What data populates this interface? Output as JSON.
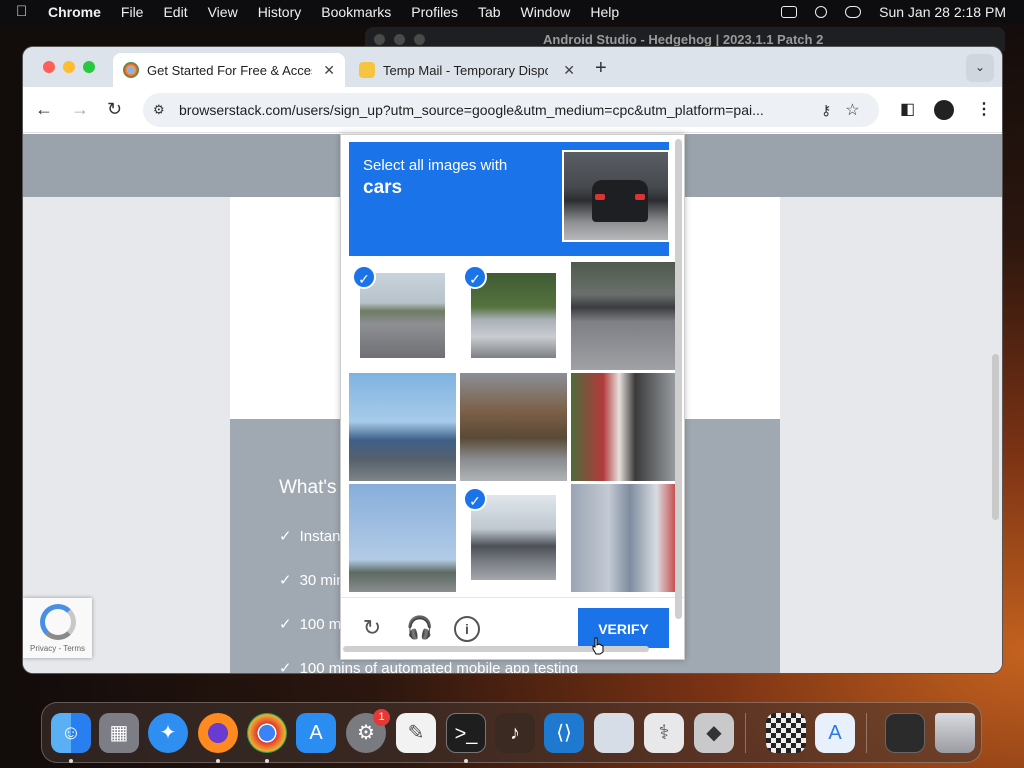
{
  "menubar": {
    "app": "Chrome",
    "menus": [
      "File",
      "Edit",
      "View",
      "History",
      "Bookmarks",
      "Profiles",
      "Tab",
      "Window",
      "Help"
    ],
    "clock": "Sun Jan 28  2:18 PM"
  },
  "background_window": {
    "title": "Android Studio - Hedgehog | 2023.1.1 Patch 2"
  },
  "tabs": [
    {
      "label": "Get Started For Free & Access",
      "active": true
    },
    {
      "label": "Temp Mail - Temporary Dispo",
      "active": false
    }
  ],
  "toolbar": {
    "url": "browserstack.com/users/sign_up?utm_source=google&utm_medium=cpc&utm_platform=pai..."
  },
  "page": {
    "heading": "What's",
    "features": [
      "Instant",
      "30 min",
      "100 m",
      "100 mins of automated mobile app testing"
    ],
    "recaptcha_links": "Privacy - Terms"
  },
  "captcha": {
    "instruction": "Select all images with",
    "target": "cars",
    "verify_label": "VERIFY",
    "tiles": [
      {
        "selected": true
      },
      {
        "selected": true
      },
      {
        "selected": false
      },
      {
        "selected": false
      },
      {
        "selected": false
      },
      {
        "selected": false
      },
      {
        "selected": false
      },
      {
        "selected": true
      },
      {
        "selected": false
      }
    ]
  },
  "dock": {
    "apps": [
      "Finder",
      "Launchpad",
      "Safari",
      "Firefox",
      "Chrome",
      "App Store",
      "System Settings",
      "TextEdit",
      "Terminal",
      "GarageBand",
      "Visual Studio Code",
      "Preview",
      "Disk Utility",
      "Migration",
      "Chess",
      "Xcode",
      "Screen",
      "Trash"
    ],
    "settings_badge": "1"
  }
}
